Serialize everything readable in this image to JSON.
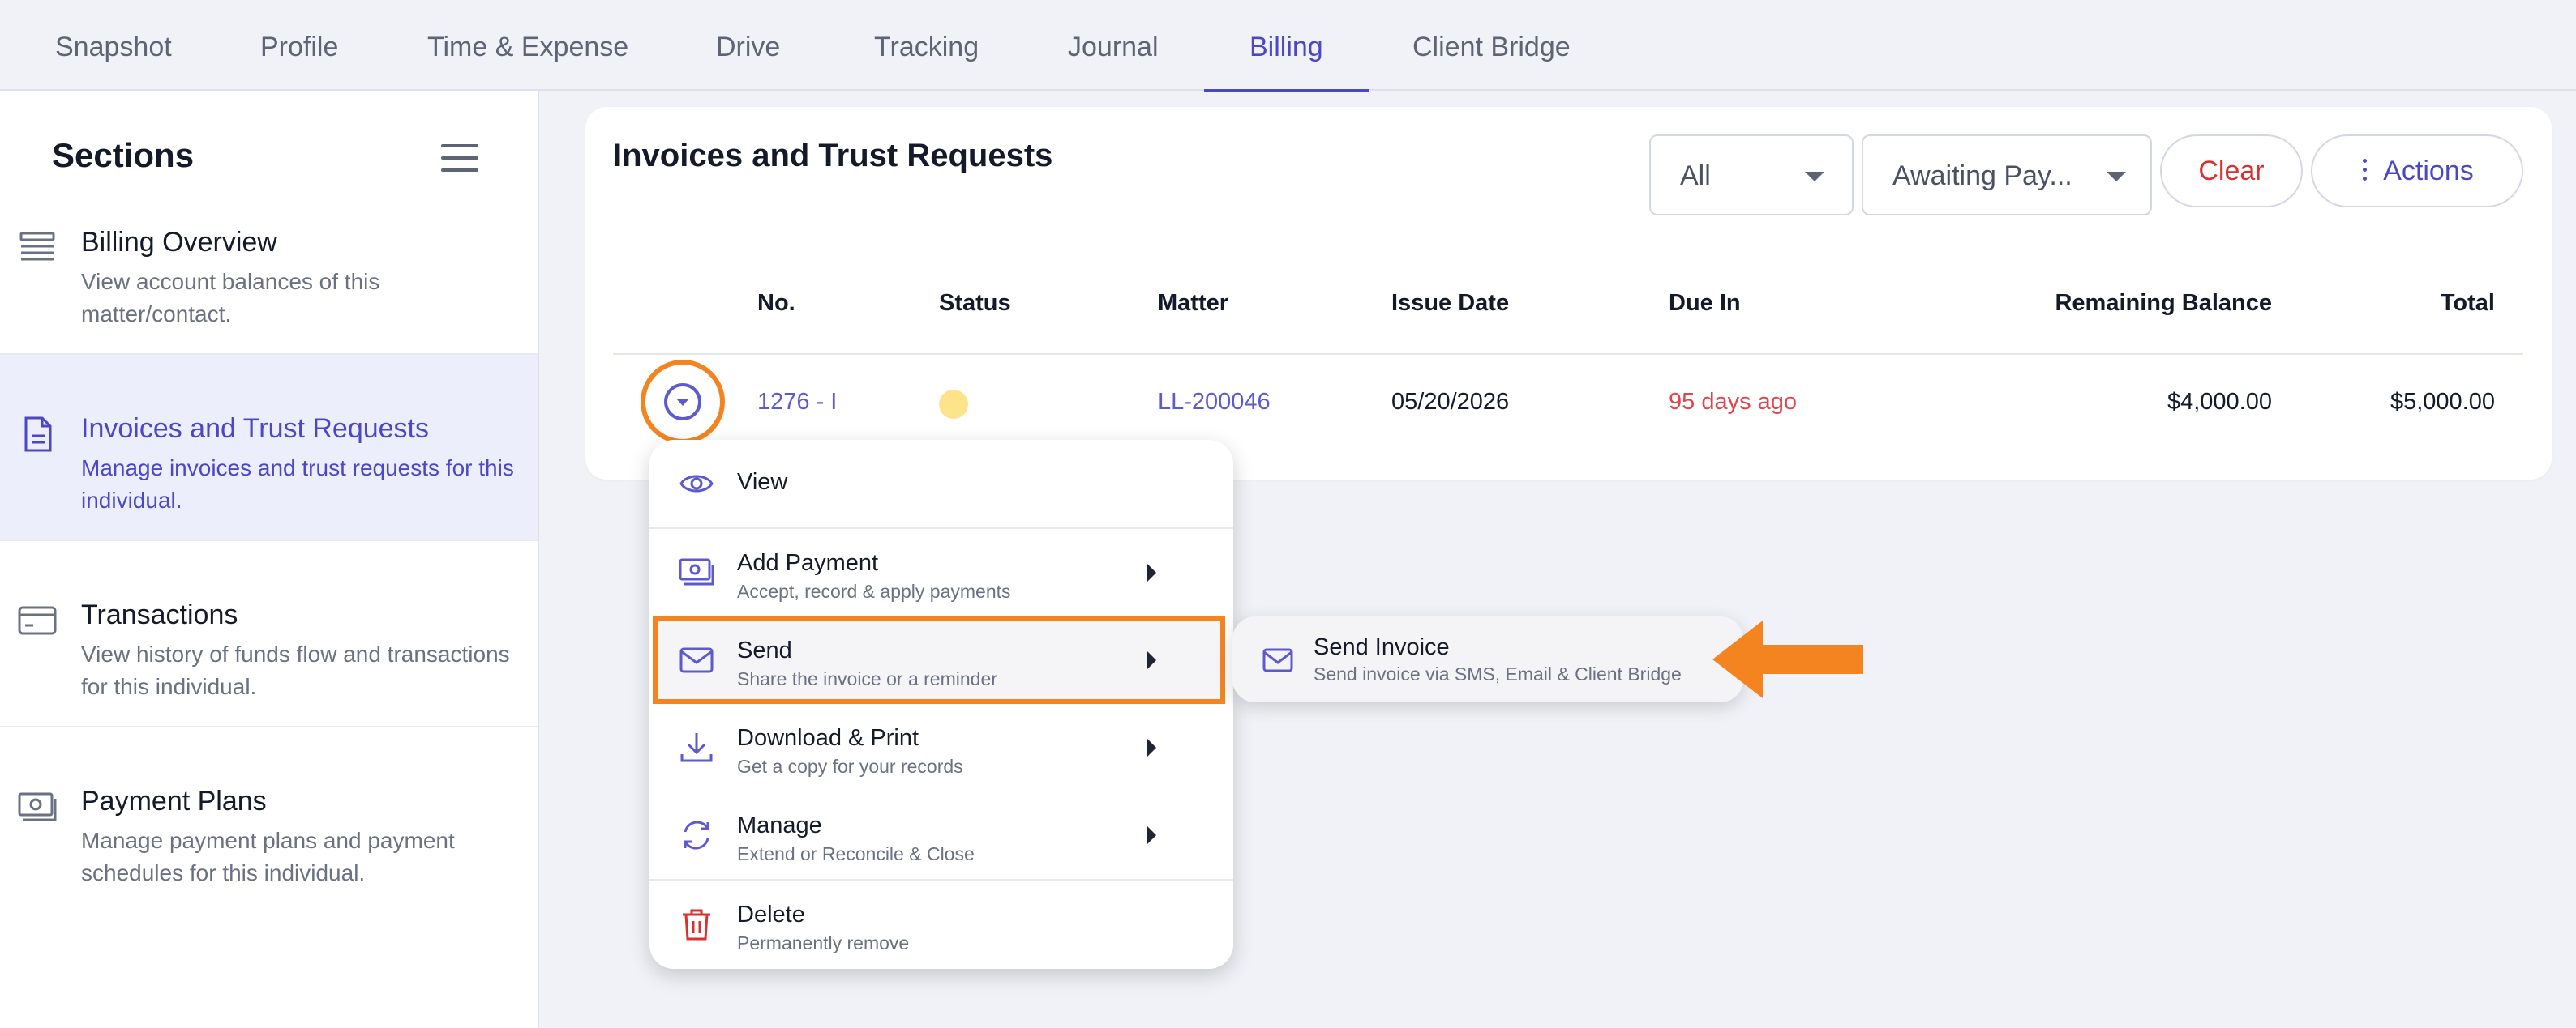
{
  "nav": {
    "tabs": [
      {
        "label": "Snapshot"
      },
      {
        "label": "Profile"
      },
      {
        "label": "Time & Expense"
      },
      {
        "label": "Drive"
      },
      {
        "label": "Tracking"
      },
      {
        "label": "Journal"
      },
      {
        "label": "Billing"
      },
      {
        "label": "Client Bridge"
      }
    ],
    "active_tab": "Billing"
  },
  "sidebar": {
    "title": "Sections",
    "items": [
      {
        "title": "Billing Overview",
        "desc": "View account balances of this matter/contact.",
        "icon": "list-icon"
      },
      {
        "title": "Invoices and Trust Requests",
        "desc": "Manage invoices and trust requests for this individual.",
        "icon": "document-icon"
      },
      {
        "title": "Transactions",
        "desc": "View history of funds flow and transactions for this individual.",
        "icon": "credit-card-icon"
      },
      {
        "title": "Payment Plans",
        "desc": "Manage payment plans and payment schedules for this individual.",
        "icon": "money-icon"
      }
    ]
  },
  "main": {
    "title": "Invoices and Trust Requests",
    "filters": {
      "type": "All",
      "status": "Awaiting Pay..."
    },
    "clear_label": "Clear",
    "actions_label": "Actions",
    "table": {
      "columns": [
        "No.",
        "Status",
        "Matter",
        "Issue Date",
        "Due In",
        "Remaining Balance",
        "Total"
      ],
      "rows": [
        {
          "no": "1276 - I",
          "status_color": "#fde48a",
          "matter": "LL-200046",
          "issue_date": "05/20/2026",
          "due_in": "95 days ago",
          "remaining_balance": "$4,000.00",
          "total": "$5,000.00"
        }
      ]
    }
  },
  "menu": {
    "items": [
      {
        "label": "View",
        "sub": "",
        "icon": "eye-icon"
      },
      {
        "label": "Add Payment",
        "sub": "Accept, record & apply payments",
        "icon": "money-icon"
      },
      {
        "label": "Send",
        "sub": "Share the invoice or a reminder",
        "icon": "mail-icon"
      },
      {
        "label": "Download & Print",
        "sub": "Get a copy for your records",
        "icon": "download-icon"
      },
      {
        "label": "Manage",
        "sub": "Extend or Reconcile & Close",
        "icon": "refresh-icon"
      },
      {
        "label": "Delete",
        "sub": "Permanently remove",
        "icon": "trash-icon"
      }
    ]
  },
  "submenu": {
    "label": "Send Invoice",
    "sub": "Send invoice via SMS, Email & Client Bridge",
    "icon": "mail-icon"
  },
  "colors": {
    "accent": "#4b47c7",
    "highlight": "#f4841f",
    "danger": "#d93030"
  }
}
